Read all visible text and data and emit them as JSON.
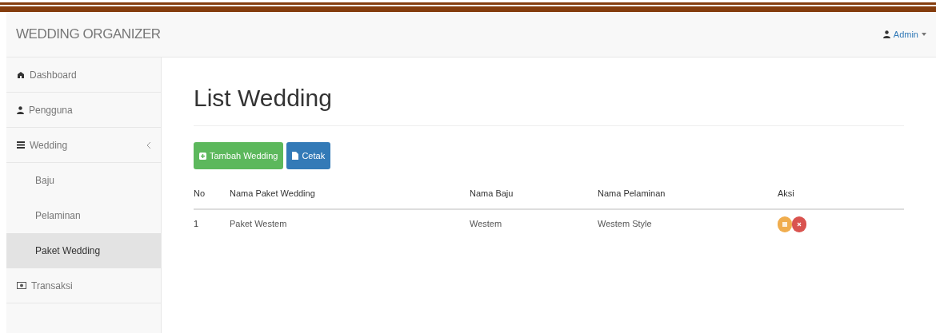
{
  "navbar": {
    "brand": "WEDDING ORGANIZER",
    "user": "Admin"
  },
  "sidebar": {
    "items": [
      {
        "label": "Dashboard",
        "kind": "dashboard",
        "selected": false
      },
      {
        "label": "Pengguna",
        "kind": "user",
        "selected": false
      },
      {
        "label": "Wedding",
        "kind": "list",
        "selected": false,
        "expanded": true,
        "children": [
          {
            "label": "Baju",
            "selected": false
          },
          {
            "label": "Pelaminan",
            "selected": false
          },
          {
            "label": "Paket Wedding",
            "selected": true
          }
        ]
      },
      {
        "label": "Transaksi",
        "kind": "money",
        "selected": false
      }
    ]
  },
  "page": {
    "title": "List Wedding",
    "buttons": [
      {
        "label": "Tambah Wedding",
        "kind": "add"
      },
      {
        "label": "Cetak",
        "kind": "print"
      }
    ]
  },
  "table": {
    "columns": [
      "No",
      "Nama Paket Wedding",
      "Nama Baju",
      "Nama Pelaminan",
      "Aksi"
    ],
    "rows": [
      {
        "cells": [
          "1",
          "Paket Westem",
          "Westem",
          "Westem Style"
        ]
      }
    ]
  }
}
